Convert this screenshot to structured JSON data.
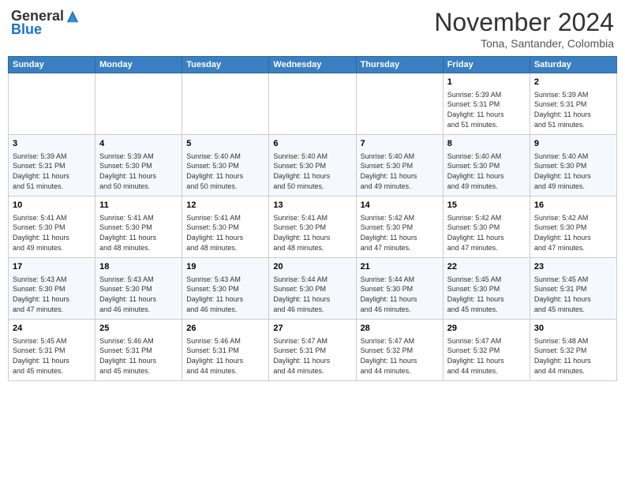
{
  "header": {
    "logo_general": "General",
    "logo_blue": "Blue",
    "month": "November 2024",
    "location": "Tona, Santander, Colombia"
  },
  "days_of_week": [
    "Sunday",
    "Monday",
    "Tuesday",
    "Wednesday",
    "Thursday",
    "Friday",
    "Saturday"
  ],
  "weeks": [
    [
      {
        "day": "",
        "info": ""
      },
      {
        "day": "",
        "info": ""
      },
      {
        "day": "",
        "info": ""
      },
      {
        "day": "",
        "info": ""
      },
      {
        "day": "",
        "info": ""
      },
      {
        "day": "1",
        "info": "Sunrise: 5:39 AM\nSunset: 5:31 PM\nDaylight: 11 hours\nand 51 minutes."
      },
      {
        "day": "2",
        "info": "Sunrise: 5:39 AM\nSunset: 5:31 PM\nDaylight: 11 hours\nand 51 minutes."
      }
    ],
    [
      {
        "day": "3",
        "info": "Sunrise: 5:39 AM\nSunset: 5:31 PM\nDaylight: 11 hours\nand 51 minutes."
      },
      {
        "day": "4",
        "info": "Sunrise: 5:39 AM\nSunset: 5:30 PM\nDaylight: 11 hours\nand 50 minutes."
      },
      {
        "day": "5",
        "info": "Sunrise: 5:40 AM\nSunset: 5:30 PM\nDaylight: 11 hours\nand 50 minutes."
      },
      {
        "day": "6",
        "info": "Sunrise: 5:40 AM\nSunset: 5:30 PM\nDaylight: 11 hours\nand 50 minutes."
      },
      {
        "day": "7",
        "info": "Sunrise: 5:40 AM\nSunset: 5:30 PM\nDaylight: 11 hours\nand 49 minutes."
      },
      {
        "day": "8",
        "info": "Sunrise: 5:40 AM\nSunset: 5:30 PM\nDaylight: 11 hours\nand 49 minutes."
      },
      {
        "day": "9",
        "info": "Sunrise: 5:40 AM\nSunset: 5:30 PM\nDaylight: 11 hours\nand 49 minutes."
      }
    ],
    [
      {
        "day": "10",
        "info": "Sunrise: 5:41 AM\nSunset: 5:30 PM\nDaylight: 11 hours\nand 49 minutes."
      },
      {
        "day": "11",
        "info": "Sunrise: 5:41 AM\nSunset: 5:30 PM\nDaylight: 11 hours\nand 48 minutes."
      },
      {
        "day": "12",
        "info": "Sunrise: 5:41 AM\nSunset: 5:30 PM\nDaylight: 11 hours\nand 48 minutes."
      },
      {
        "day": "13",
        "info": "Sunrise: 5:41 AM\nSunset: 5:30 PM\nDaylight: 11 hours\nand 48 minutes."
      },
      {
        "day": "14",
        "info": "Sunrise: 5:42 AM\nSunset: 5:30 PM\nDaylight: 11 hours\nand 47 minutes."
      },
      {
        "day": "15",
        "info": "Sunrise: 5:42 AM\nSunset: 5:30 PM\nDaylight: 11 hours\nand 47 minutes."
      },
      {
        "day": "16",
        "info": "Sunrise: 5:42 AM\nSunset: 5:30 PM\nDaylight: 11 hours\nand 47 minutes."
      }
    ],
    [
      {
        "day": "17",
        "info": "Sunrise: 5:43 AM\nSunset: 5:30 PM\nDaylight: 11 hours\nand 47 minutes."
      },
      {
        "day": "18",
        "info": "Sunrise: 5:43 AM\nSunset: 5:30 PM\nDaylight: 11 hours\nand 46 minutes."
      },
      {
        "day": "19",
        "info": "Sunrise: 5:43 AM\nSunset: 5:30 PM\nDaylight: 11 hours\nand 46 minutes."
      },
      {
        "day": "20",
        "info": "Sunrise: 5:44 AM\nSunset: 5:30 PM\nDaylight: 11 hours\nand 46 minutes."
      },
      {
        "day": "21",
        "info": "Sunrise: 5:44 AM\nSunset: 5:30 PM\nDaylight: 11 hours\nand 46 minutes."
      },
      {
        "day": "22",
        "info": "Sunrise: 5:45 AM\nSunset: 5:30 PM\nDaylight: 11 hours\nand 45 minutes."
      },
      {
        "day": "23",
        "info": "Sunrise: 5:45 AM\nSunset: 5:31 PM\nDaylight: 11 hours\nand 45 minutes."
      }
    ],
    [
      {
        "day": "24",
        "info": "Sunrise: 5:45 AM\nSunset: 5:31 PM\nDaylight: 11 hours\nand 45 minutes."
      },
      {
        "day": "25",
        "info": "Sunrise: 5:46 AM\nSunset: 5:31 PM\nDaylight: 11 hours\nand 45 minutes."
      },
      {
        "day": "26",
        "info": "Sunrise: 5:46 AM\nSunset: 5:31 PM\nDaylight: 11 hours\nand 44 minutes."
      },
      {
        "day": "27",
        "info": "Sunrise: 5:47 AM\nSunset: 5:31 PM\nDaylight: 11 hours\nand 44 minutes."
      },
      {
        "day": "28",
        "info": "Sunrise: 5:47 AM\nSunset: 5:32 PM\nDaylight: 11 hours\nand 44 minutes."
      },
      {
        "day": "29",
        "info": "Sunrise: 5:47 AM\nSunset: 5:32 PM\nDaylight: 11 hours\nand 44 minutes."
      },
      {
        "day": "30",
        "info": "Sunrise: 5:48 AM\nSunset: 5:32 PM\nDaylight: 11 hours\nand 44 minutes."
      }
    ]
  ]
}
